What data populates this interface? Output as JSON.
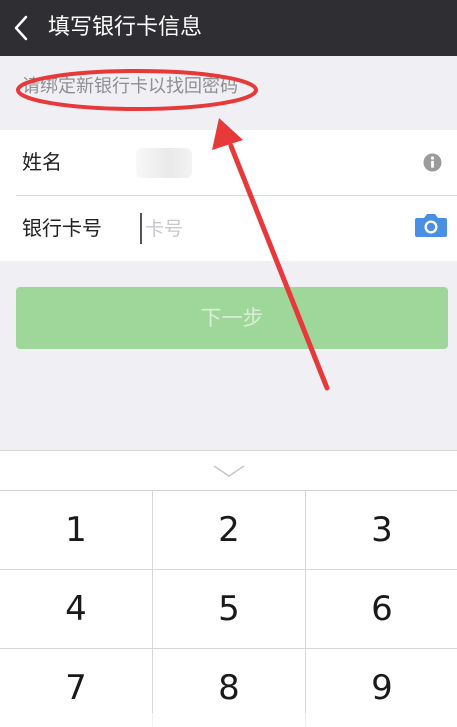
{
  "header": {
    "title": "填写银行卡信息"
  },
  "hint": {
    "text": "请绑定新银行卡以找回密码"
  },
  "form": {
    "name_label": "姓名",
    "card_label": "银行卡号",
    "card_placeholder": "卡号"
  },
  "next_button": {
    "label": "下一步"
  },
  "keyboard": {
    "keys": [
      "1",
      "2",
      "3",
      "4",
      "5",
      "6",
      "7",
      "8",
      "9"
    ]
  },
  "colors": {
    "navbar": "#2e2e33",
    "next_button": "#9fd79a",
    "annotation": "#e8393a",
    "icon": "#4a90e2"
  },
  "icons": {
    "back": "chevron-left-icon",
    "info": "info-icon",
    "camera": "camera-icon",
    "keyboard_collapse": "chevron-down-icon"
  }
}
